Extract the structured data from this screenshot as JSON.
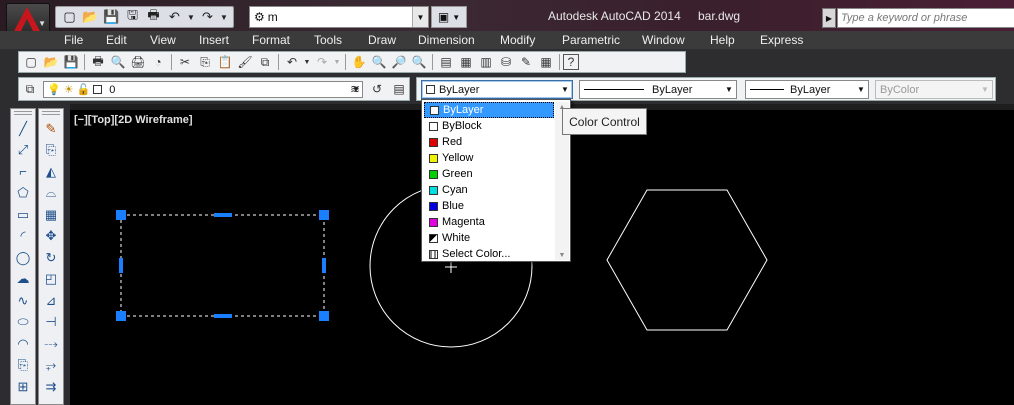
{
  "window": {
    "app_title": "Autodesk AutoCAD 2014",
    "file_name": "bar.dwg",
    "workspace": "m",
    "search_placeholder": "Type a keyword or phrase"
  },
  "menu": [
    "File",
    "Edit",
    "View",
    "Insert",
    "Format",
    "Tools",
    "Draw",
    "Dimension",
    "Modify",
    "Parametric",
    "Window",
    "Help",
    "Express"
  ],
  "layer": {
    "current": "0"
  },
  "properties": {
    "color": "ByLayer",
    "linetype": "ByLayer",
    "lineweight": "ByLayer",
    "plotstyle": "ByColor"
  },
  "viewport": {
    "label": "[−][Top][2D Wireframe]"
  },
  "color_dropdown": {
    "items": [
      {
        "label": "ByLayer",
        "swatch": "#ffffff",
        "selected": true
      },
      {
        "label": "ByBlock",
        "swatch": "#ffffff"
      },
      {
        "label": "Red",
        "swatch": "#e00000"
      },
      {
        "label": "Yellow",
        "swatch": "#f0f000"
      },
      {
        "label": "Green",
        "swatch": "#00d000"
      },
      {
        "label": "Cyan",
        "swatch": "#00e0e0"
      },
      {
        "label": "Blue",
        "swatch": "#0000e0"
      },
      {
        "label": "Magenta",
        "swatch": "#e000e0"
      },
      {
        "label": "White",
        "swatch": "split"
      },
      {
        "label": "Select Color...",
        "swatch": "grid"
      }
    ]
  },
  "tooltip": "Color Control",
  "colors": {
    "grip": "#1a7fff",
    "canvas": "#000000",
    "geometry": "#ffffff"
  }
}
